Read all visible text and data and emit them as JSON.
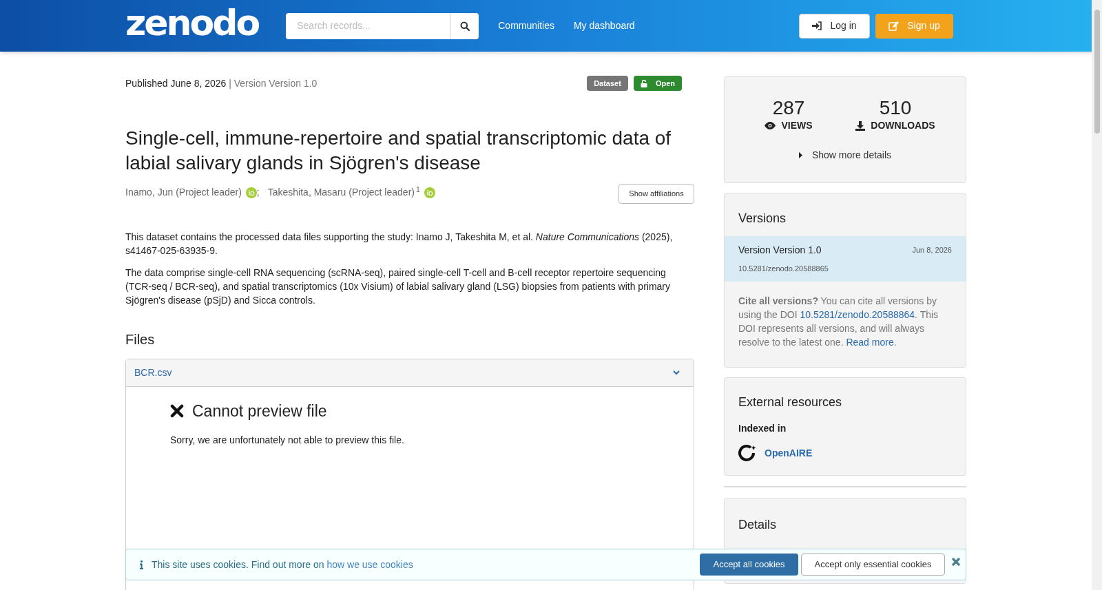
{
  "header": {
    "logo": "zenodo",
    "search": {
      "placeholder": "Search records..."
    },
    "nav": [
      "Communities",
      "My dashboard"
    ],
    "login": "Log in",
    "signup": "Sign up"
  },
  "record": {
    "published": "Published June 8, 2026",
    "version": "| Version Version 1.0",
    "badges": [
      {
        "label": "Dataset",
        "kind": "type"
      },
      {
        "label": "Open",
        "kind": "access"
      }
    ],
    "title": "Single-cell, immune-repertoire and spatial transcriptomic data of labial salivary glands in Sjögren's disease",
    "creators": [
      {
        "name": "Inamo, Jun (Project leader)",
        "sep": ";"
      },
      {
        "name": "Takeshita, Masaru (Project leader)",
        "sup": "1"
      }
    ],
    "show_affiliations": "Show affiliations",
    "description": [
      "This dataset contains the processed data files supporting the study: Inamo J, Takeshita M, et al. *Nature Communications* (2025), s41467-025-63935-9.",
      "The data comprise single-cell RNA sequencing (scRNA-seq), paired single-cell T-cell and B-cell receptor repertoire sequencing (TCR-seq / BCR-seq), and spatial transcriptomics (10x Visium) of labial salivary gland (LSG) biopsies from patients with primary Sjögren's disease (pSjD) and Sicca controls."
    ]
  },
  "files": {
    "heading": "Files",
    "file": "BCR.csv",
    "expanded": true,
    "preview_title": "Cannot preview file",
    "preview_message": "Sorry, we are unfortunately not able to preview this file."
  },
  "stats": {
    "views": "287",
    "views_label": "VIEWS",
    "downloads": "510",
    "downloads_label": "DOWNLOADS",
    "more": "Show more details"
  },
  "versions": {
    "heading": "Versions",
    "items": [
      {
        "title": "Version Version 1.0",
        "date": "Jun 8, 2026",
        "doi": "10.5281/zenodo.20588865",
        "selected": true
      }
    ],
    "cite_bold": "Cite all versions?",
    "cite_text": "You can cite all versions by using the DOI",
    "cite_doi": "10.5281/zenodo.20588864",
    "cite_text2": ". This DOI represents all versions, and will always resolve to the latest one.",
    "read_more": "Read more",
    "end": "."
  },
  "external": {
    "heading": "External resources",
    "indexed": "Indexed in",
    "resource": "OpenAIRE"
  },
  "details": {
    "heading": "Details"
  },
  "cookies": {
    "text": "This site uses cookies. Find out more on",
    "link": "how we use cookies",
    "accept_all": "Accept all cookies",
    "accept_essential": "Accept only essential cookies"
  }
}
